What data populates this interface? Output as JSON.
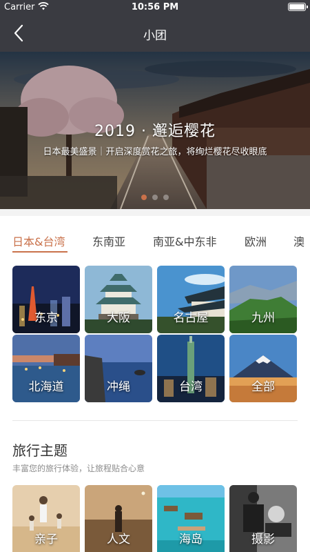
{
  "status_bar": {
    "carrier": "Carrier",
    "time": "10:56 PM"
  },
  "nav": {
    "title": "小团"
  },
  "banner": {
    "title": "2019 · 邂逅樱花",
    "subtitle": "日本最美盛景｜开启深度赏花之旅，将绚烂樱花尽收眼底"
  },
  "tabs": [
    "日本&台湾",
    "东南亚",
    "南亚&中东非",
    "欧洲",
    "澳"
  ],
  "destinations": [
    "东京",
    "大阪",
    "名古屋",
    "九州",
    "北海道",
    "冲绳",
    "台湾",
    "全部"
  ],
  "themes_section": {
    "title": "旅行主题",
    "subtitle": "丰富您的旅行体验，让旅程贴合心意",
    "items": [
      "亲子",
      "人文",
      "海岛",
      "摄影"
    ]
  },
  "colors": {
    "accent": "#c9714a",
    "nav_bg": "#3a3b41"
  }
}
